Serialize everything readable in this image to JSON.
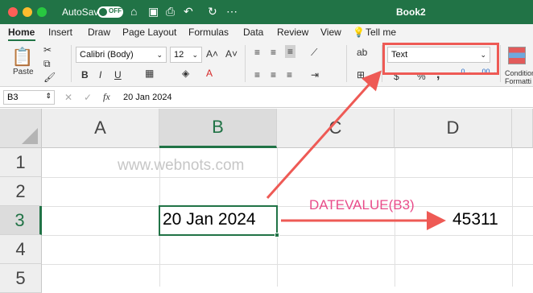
{
  "titlebar": {
    "autosave_label": "AutoSave",
    "autosave_state": "OFF",
    "book_title": "Book2",
    "colors": {
      "bar": "#217346",
      "close": "#ff5f57",
      "min": "#febc2e",
      "max": "#28c840"
    },
    "icons": [
      "home-icon",
      "save-icon",
      "print-icon",
      "undo-icon",
      "redo-icon",
      "more-icon"
    ]
  },
  "tabs": [
    "Home",
    "Insert",
    "Draw",
    "Page Layout",
    "Formulas",
    "Data",
    "Review",
    "View",
    "Tell me"
  ],
  "ribbon": {
    "paste_label": "Paste",
    "font_name": "Calibri (Body)",
    "font_size": "12",
    "bold": "B",
    "italic": "I",
    "underline": "U",
    "number_format": "Text",
    "currency": "$",
    "percent": "%",
    "comma": ",",
    "conditional_label": "Condition Formatti"
  },
  "formula_bar": {
    "name_box": "B3",
    "fx": "fx",
    "content": "20 Jan 2024"
  },
  "grid": {
    "columns": [
      "A",
      "B",
      "C",
      "D"
    ],
    "rows": [
      "1",
      "2",
      "3",
      "4",
      "5"
    ],
    "cells": {
      "B3": "20 Jan 2024",
      "D3": "45311"
    },
    "selected_cell": "B3"
  },
  "annotations": {
    "watermark": "www.webnots.com",
    "formula_label": "DATEVALUE(B3)",
    "accent_color": "#ee5a55",
    "label_color": "#e94c8a"
  }
}
